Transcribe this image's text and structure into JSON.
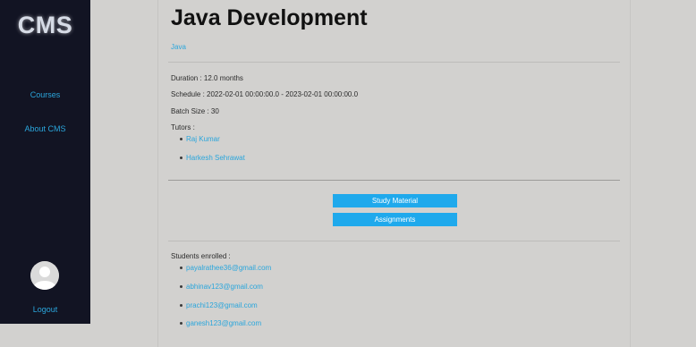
{
  "sidebar": {
    "brand": "CMS",
    "nav": [
      {
        "label": "Courses"
      },
      {
        "label": "About CMS"
      }
    ],
    "logout_label": "Logout"
  },
  "course": {
    "title": "Java Development",
    "tag": "Java",
    "duration": "Duration : 12.0 months",
    "schedule": "Schedule : 2022-02-01 00:00:00.0 - 2023-02-01 00:00:00.0",
    "batch_size": "Batch Size : 30",
    "tutors_label": "Tutors :",
    "tutors": [
      "Raj Kumar",
      "Harkesh Sehrawat"
    ]
  },
  "actions": {
    "study_material": "Study Material",
    "assignments": "Assignments"
  },
  "students": {
    "label": "Students enrolled :",
    "list": [
      "payalrathee36@gmail.com",
      "abhinav123@gmail.com",
      "prachi123@gmail.com",
      "ganesh123@gmail.com"
    ]
  },
  "colors": {
    "sidebar_bg": "#121423",
    "page_bg": "#d2d1cf",
    "link": "#2aa6dc",
    "button": "#1fa9ec"
  }
}
